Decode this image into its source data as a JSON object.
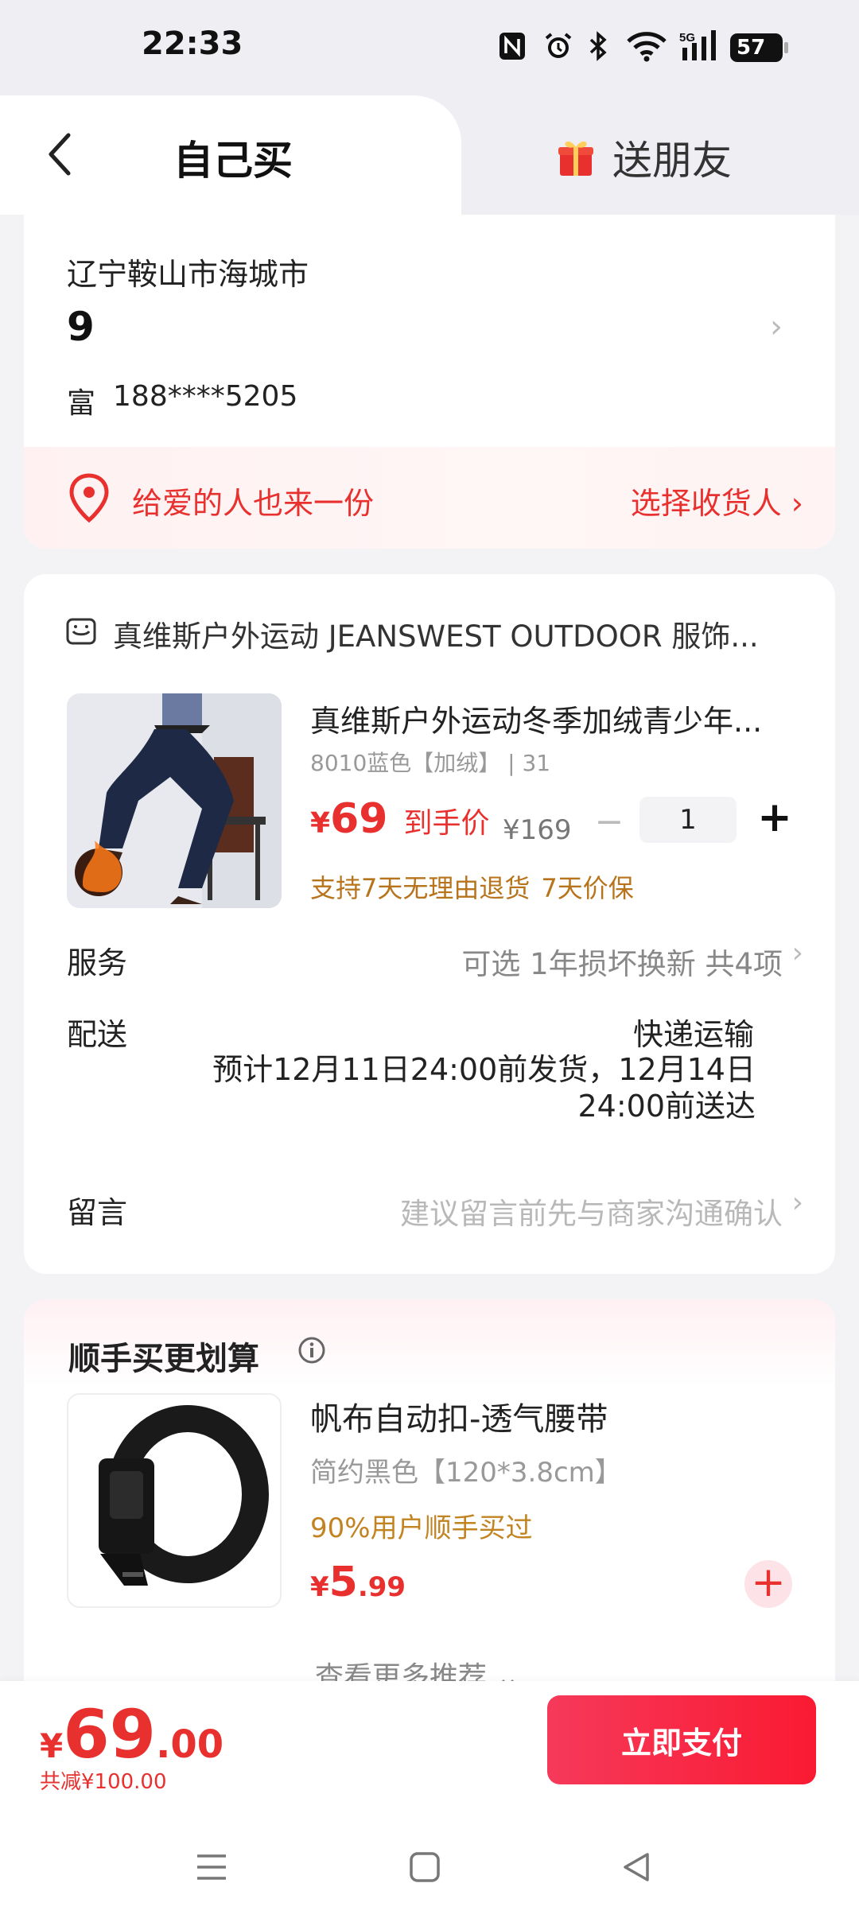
{
  "status_bar": {
    "time": "22:33",
    "network": "5G",
    "battery": "57",
    "icons": [
      "nfc-icon",
      "alarm-icon",
      "bluetooth-icon",
      "wifi-icon",
      "signal-icon",
      "battery-icon"
    ]
  },
  "tabs": {
    "self": "自己买",
    "friend": "送朋友"
  },
  "address": {
    "region": "辽宁鞍山市海城市",
    "detail": "9",
    "name": "富",
    "phone": "188****5205",
    "gift_prompt": "给爱的人也来一份",
    "gift_action": "选择收货人"
  },
  "order": {
    "store": "真维斯户外运动 JEANSWEST OUTDOOR 服饰...",
    "product_title": "真维斯户外运动冬季加绒青少年...",
    "spec": "8010蓝色【加绒】 | 31",
    "price_symbol": "¥",
    "price": "69",
    "price_tag": "到手价",
    "original_price": "¥169",
    "quantity": "1",
    "guarantee_return": "支持7天无理由退货",
    "guarantee_price": "7天价保",
    "service_label": "服务",
    "service_value": "可选 1年损坏换新 共4项",
    "delivery_label": "配送",
    "delivery_method": "快递运输",
    "delivery_eta": "预计12月11日24:00前发货，12月14日24:00前送达",
    "message_label": "留言",
    "message_placeholder": "建议留言前先与商家沟通确认"
  },
  "recommend": {
    "title": "顺手买更划算",
    "item_name": "帆布自动扣-透气腰带",
    "item_spec": "简约黑色【120*3.8cm】",
    "item_note": "90%用户顺手买过",
    "price_symbol": "¥",
    "price_int": "5",
    "price_dec": ".99",
    "more": "查看更多推荐 ⌄"
  },
  "checkout": {
    "symbol": "¥",
    "total_int": "69",
    "total_dec": ".00",
    "discount": "共减¥100.00",
    "pay_button": "立即支付"
  },
  "colors": {
    "accent_red": "#e8312f",
    "pay_gradient_start": "#f6395a",
    "pay_gradient_end": "#fa1a32",
    "guarantee_orange": "#b7741c"
  }
}
